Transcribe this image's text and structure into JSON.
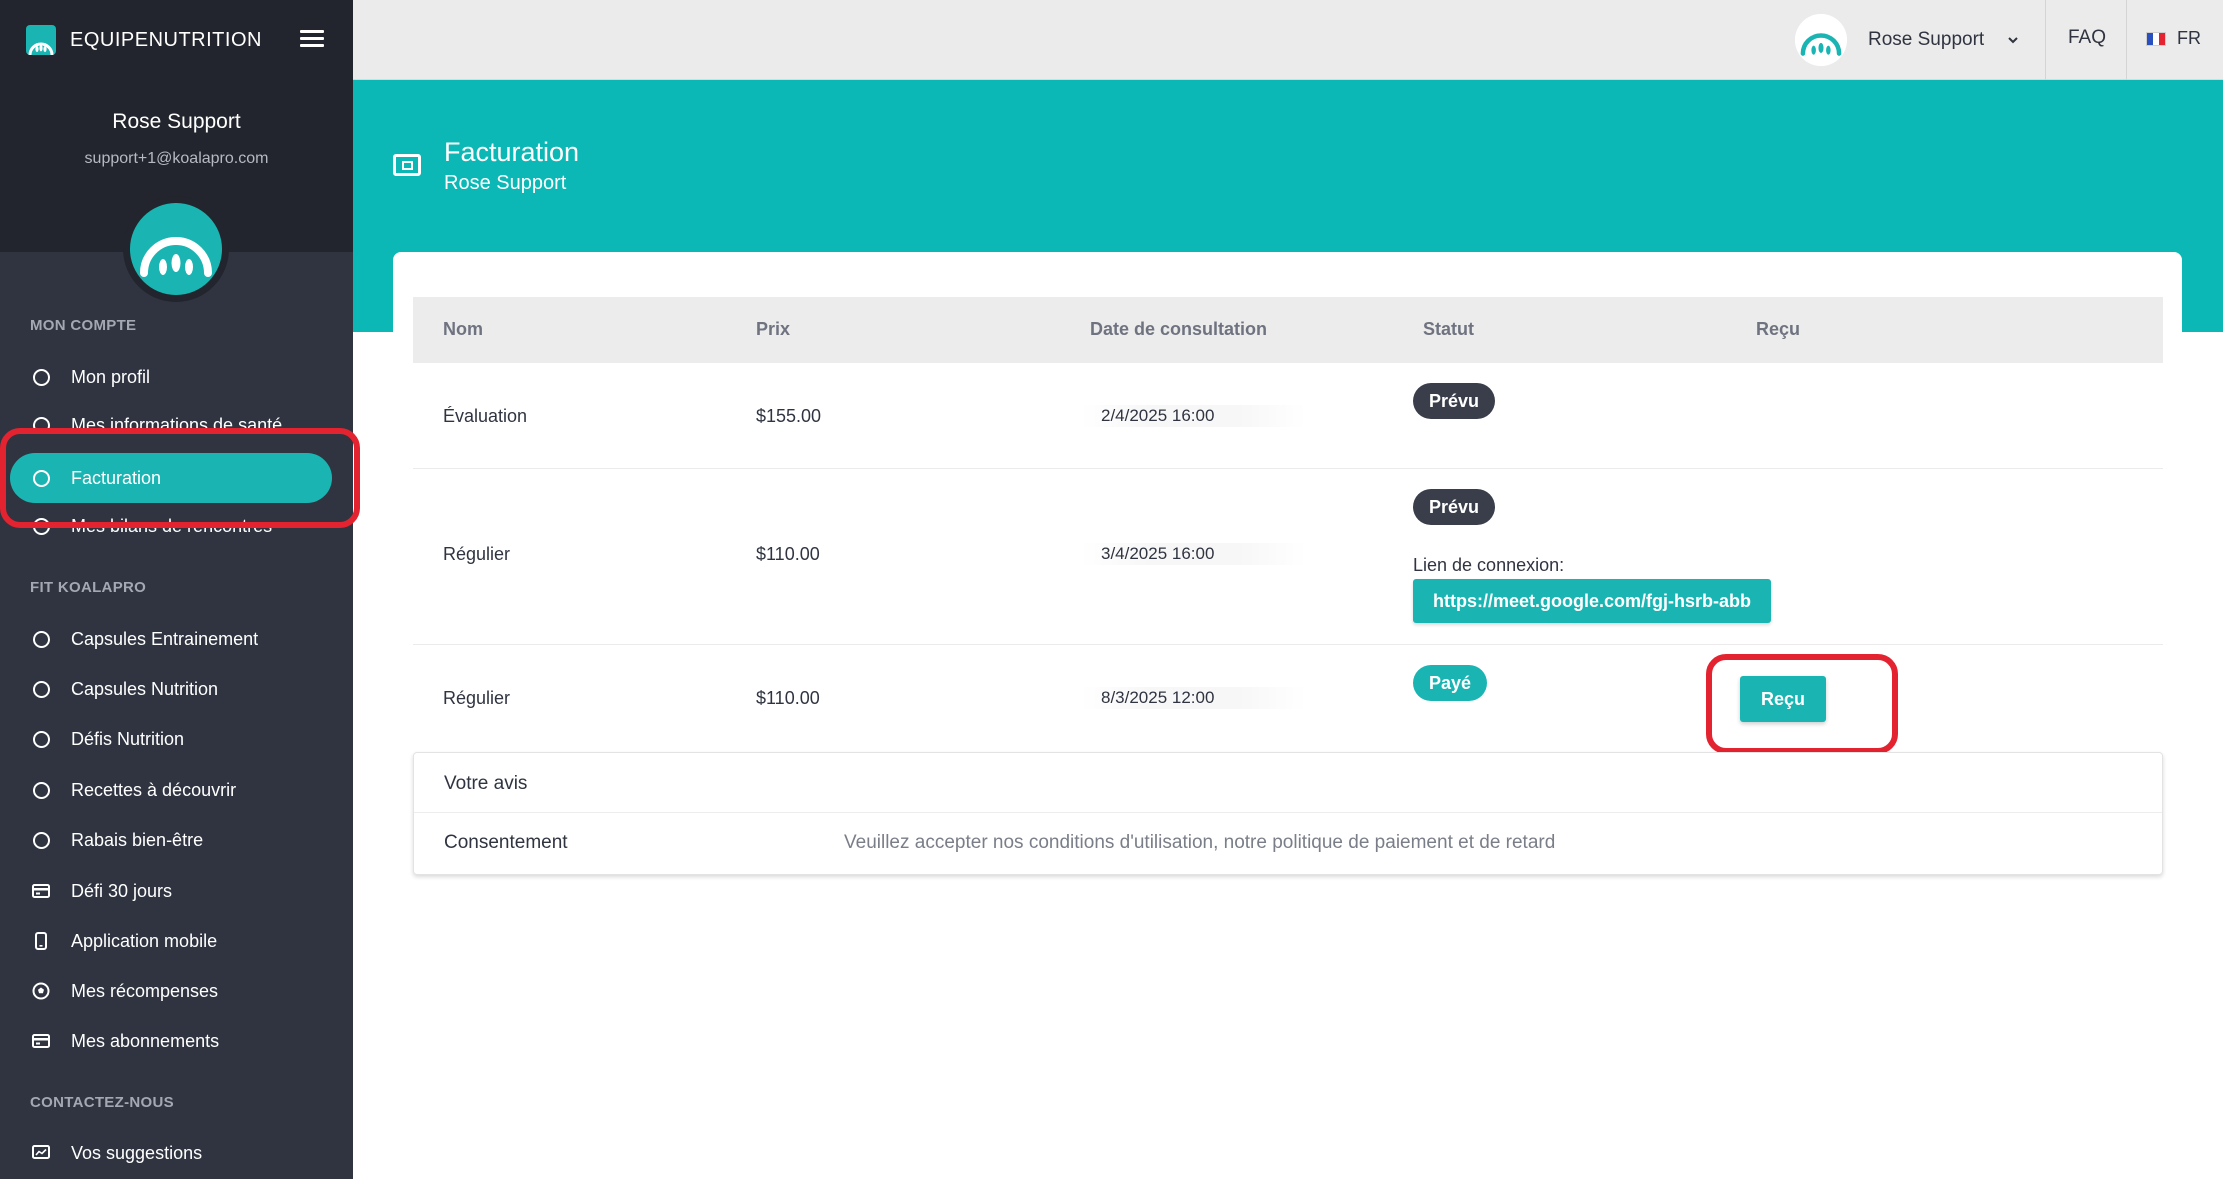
{
  "sidebar": {
    "brand": "EQUIPENUTRITION",
    "user": {
      "name": "Rose Support",
      "email": "support+1@koalapro.com"
    },
    "sections": [
      {
        "title": "MON COMPTE",
        "items": [
          {
            "label": "Mon profil",
            "icon": "circle-icon"
          },
          {
            "label": "Mes informations de santé",
            "icon": "circle-icon"
          },
          {
            "label": "Facturation",
            "icon": "circle-icon",
            "active": true
          },
          {
            "label": "Mes bilans de rencontres",
            "icon": "circle-icon"
          }
        ]
      },
      {
        "title": "FIT KOALAPRO",
        "items": [
          {
            "label": "Capsules Entrainement",
            "icon": "circle-icon"
          },
          {
            "label": "Capsules Nutrition",
            "icon": "circle-icon"
          },
          {
            "label": "Défis Nutrition",
            "icon": "circle-icon"
          },
          {
            "label": "Recettes à découvrir",
            "icon": "circle-icon"
          },
          {
            "label": "Rabais bien-être",
            "icon": "circle-icon"
          },
          {
            "label": "Défi 30 jours",
            "icon": "card-icon"
          },
          {
            "label": "Application mobile",
            "icon": "mobile-icon"
          },
          {
            "label": "Mes récompenses",
            "icon": "soccer-ball-icon"
          },
          {
            "label": "Mes abonnements",
            "icon": "card-icon"
          }
        ]
      },
      {
        "title": "CONTACTEZ-NOUS",
        "items": [
          {
            "label": "Vos suggestions",
            "icon": "feedback-icon"
          }
        ]
      }
    ]
  },
  "topbar": {
    "username": "Rose Support",
    "faq": "FAQ",
    "lang": "FR"
  },
  "header": {
    "title": "Facturation",
    "subtitle": "Rose Support"
  },
  "table": {
    "columns": [
      "Nom",
      "Prix",
      "Date de consultation",
      "Statut",
      "Reçu"
    ],
    "rows": [
      {
        "name": "Évaluation",
        "price": "$155.00",
        "date": "2/4/2025 16:00",
        "status": "Prévu"
      },
      {
        "name": "Régulier",
        "price": "$110.00",
        "date": "3/4/2025 16:00",
        "status": "Prévu",
        "link_label": "Lien de connexion:",
        "link": "https://meet.google.com/fgj-hsrb-abb"
      },
      {
        "name": "Régulier",
        "price": "$110.00",
        "date": "8/3/2025 12:00",
        "status": "Payé",
        "receipt": "Reçu"
      }
    ]
  },
  "feedback": {
    "votre_avis": "Votre avis",
    "consent_label": "Consentement",
    "consent_text": "Veuillez accepter nos conditions d'utilisation, notre politique de paiement et de retard"
  },
  "colors": {
    "teal": "#0bb8b5",
    "sidebar": "#2f3440",
    "dark_badge": "#3a3e4b",
    "highlight": "#e3232f"
  }
}
